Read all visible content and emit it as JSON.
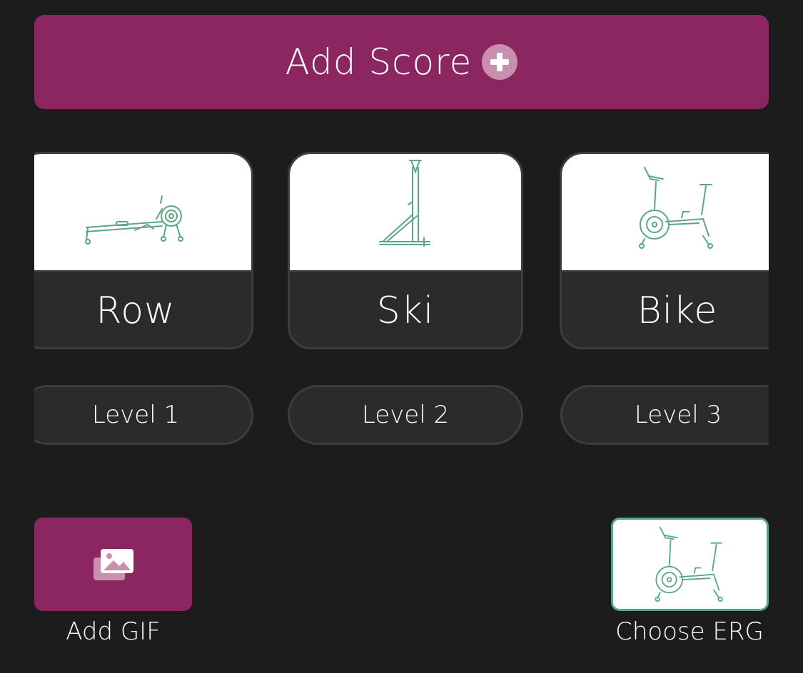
{
  "header": {
    "add_score_label": "Add Score",
    "add_icon": "plus-circle-icon"
  },
  "ergs": [
    {
      "label": "Row",
      "icon": "rower-icon"
    },
    {
      "label": "Ski",
      "icon": "ski-erg-icon"
    },
    {
      "label": "Bike",
      "icon": "air-bike-icon"
    }
  ],
  "levels": [
    {
      "label": "Level 1"
    },
    {
      "label": "Level 2"
    },
    {
      "label": "Level 3"
    }
  ],
  "actions": {
    "add_gif_label": "Add GIF",
    "add_gif_icon": "images-icon",
    "choose_erg_label": "Choose ERG",
    "choose_erg_icon": "air-bike-icon"
  },
  "colors": {
    "background": "#1c1c1c",
    "accent": "#8c2660",
    "card": "#2b2b2b",
    "card_border": "#3d3d3d",
    "icon_green": "#5aa783"
  }
}
